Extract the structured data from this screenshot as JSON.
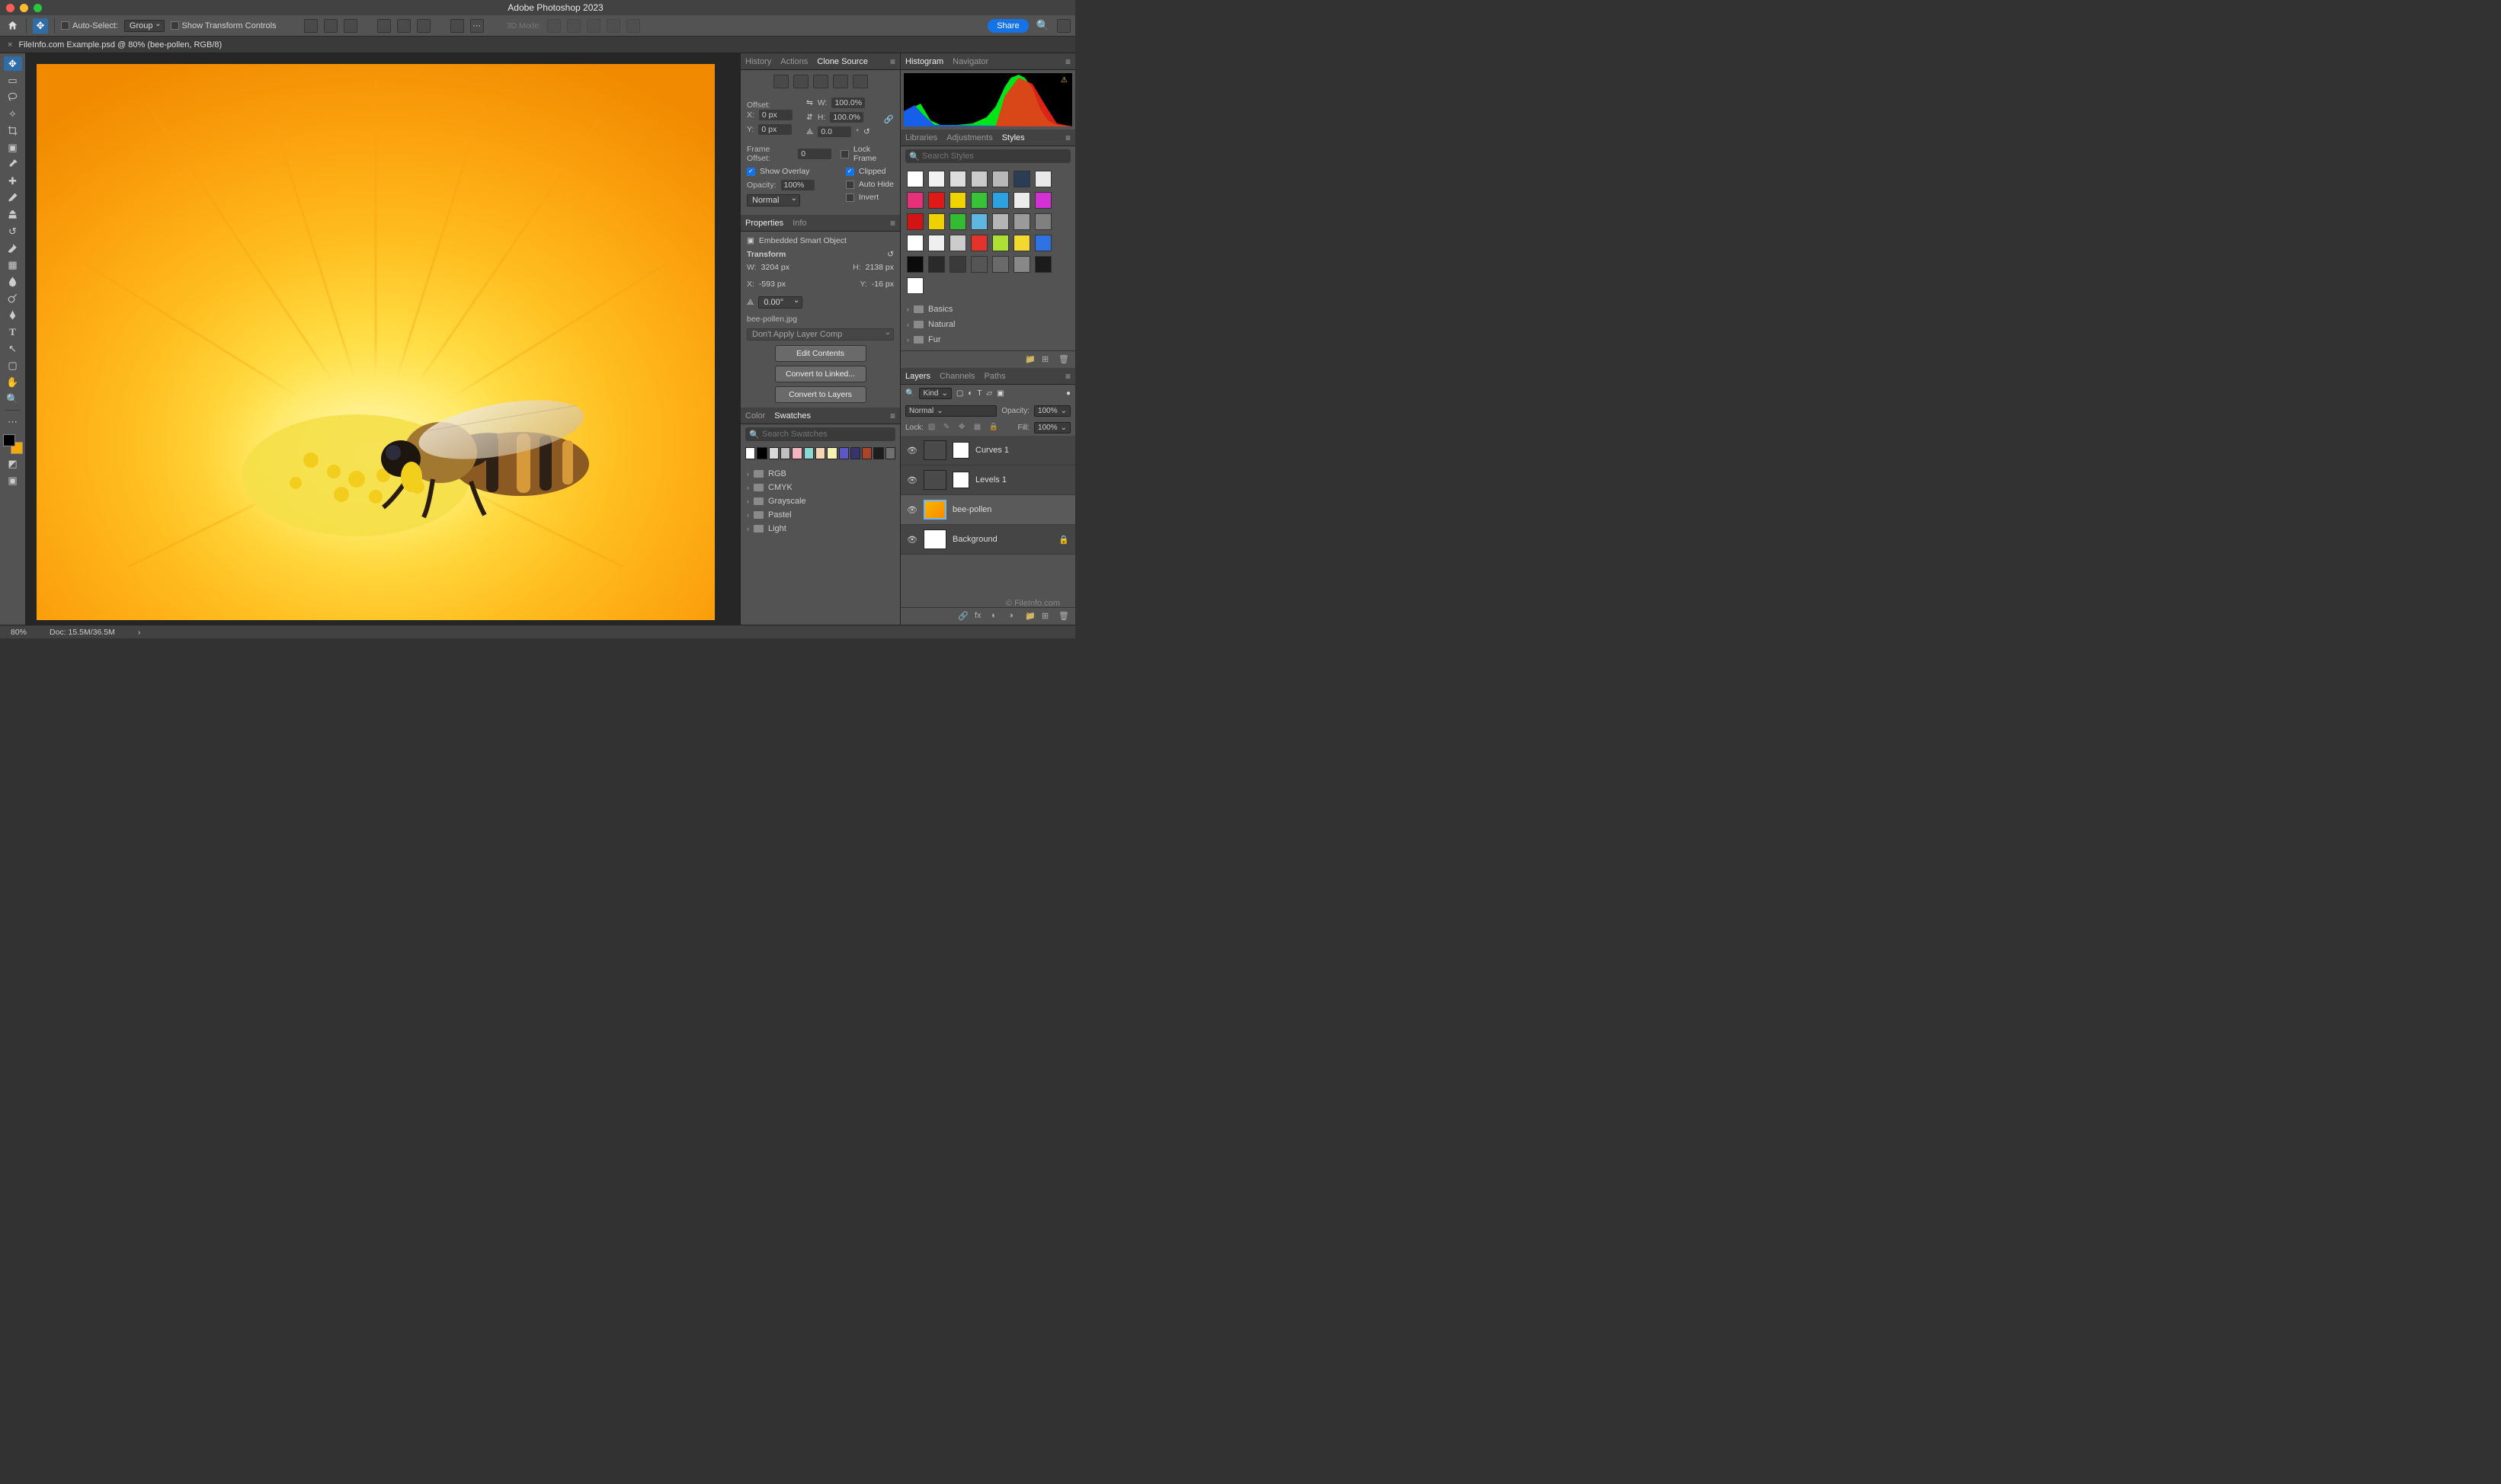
{
  "titlebar": {
    "title": "Adobe Photoshop 2023"
  },
  "optionsbar": {
    "auto_select_label": "Auto-Select:",
    "auto_select_target": "Group",
    "show_transform_label": "Show Transform Controls",
    "mode_3d_label": "3D Mode:",
    "share_label": "Share"
  },
  "doctab": {
    "label": "FileInfo.com Example.psd @ 80% (bee-pollen, RGB/8)"
  },
  "panels_left": {
    "tabs1": [
      "History",
      "Actions",
      "Clone Source"
    ],
    "tabs1_active": "Clone Source",
    "clone_source": {
      "offset_label": "Offset:",
      "x_label": "X:",
      "x_value": "0 px",
      "y_label": "Y:",
      "y_value": "0 px",
      "w_label": "W:",
      "w_value": "100.0%",
      "h_label": "H:",
      "h_value": "100.0%",
      "angle_value": "0.0",
      "frame_offset_label": "Frame Offset:",
      "frame_offset_value": "0",
      "lock_frame_label": "Lock Frame",
      "show_overlay_label": "Show Overlay",
      "clipped_label": "Clipped",
      "opacity_label": "Opacity:",
      "opacity_value": "100%",
      "auto_hide_label": "Auto Hide",
      "invert_label": "Invert",
      "blend_mode": "Normal"
    },
    "tabs2": [
      "Properties",
      "Info"
    ],
    "tabs2_active": "Properties",
    "properties": {
      "kind": "Embedded Smart Object",
      "transform_label": "Transform",
      "w_label": "W:",
      "w_value": "3204 px",
      "h_label": "H:",
      "h_value": "2138 px",
      "x_label": "X:",
      "x_value": "-593 px",
      "y_label": "Y:",
      "y_value": "-16 px",
      "angle_value": "0.00°",
      "source_file": "bee-pollen.jpg",
      "layer_comp": "Don't Apply Layer Comp",
      "btn_edit": "Edit Contents",
      "btn_linked": "Convert to Linked...",
      "btn_layers": "Convert to Layers"
    },
    "tabs3": [
      "Color",
      "Swatches"
    ],
    "tabs3_active": "Swatches",
    "swatches": {
      "search_placeholder": "Search Swatches",
      "row_colors": [
        "#ffffff",
        "#000000",
        "#d9d9d9",
        "#bfbfbf",
        "#f6b4c1",
        "#8bd9d4",
        "#f6d5b4",
        "#f5f3b4",
        "#5c57c9",
        "#37346f",
        "#ab452a",
        "#1d1d1d",
        "#707070"
      ],
      "folders": [
        "RGB",
        "CMYK",
        "Grayscale",
        "Pastel",
        "Light"
      ]
    }
  },
  "panels_right": {
    "tabs1": [
      "Histogram",
      "Navigator"
    ],
    "tabs1_active": "Histogram",
    "tabs2": [
      "Libraries",
      "Adjustments",
      "Styles"
    ],
    "tabs2_active": "Styles",
    "styles": {
      "search_placeholder": "Search Styles",
      "swatches": [
        "#ffffff",
        "#f1f1f1",
        "#dddddd",
        "#cacaca",
        "#b8b8b8",
        "#2b3d55",
        "#e9e9e9",
        "#e6307a",
        "#e01818",
        "#f0d400",
        "#38c238",
        "#2da2e0",
        "#ececec",
        "#d331d3",
        "#d41414",
        "#eed200",
        "#33bb33",
        "#5db7e0",
        "#b5b5b5",
        "#9a9a9a",
        "#808080",
        "#ffffff",
        "#efefef",
        "#cccccc",
        "#e4332b",
        "#aee033",
        "#f2d82f",
        "#2f72e4",
        "#0b0b0b",
        "#2a2a2a",
        "#3a3a3a",
        "#555555",
        "#6a6a6a",
        "#888888",
        "#1b1b1b",
        "#ffffff"
      ],
      "folders": [
        "Basics",
        "Natural",
        "Fur"
      ]
    },
    "tabs3": [
      "Layers",
      "Channels",
      "Paths"
    ],
    "tabs3_active": "Layers",
    "layers": {
      "kind_label": "Kind",
      "blend_mode": "Normal",
      "opacity_label": "Opacity:",
      "opacity_value": "100%",
      "lock_label": "Lock:",
      "fill_label": "Fill:",
      "fill_value": "100%",
      "list": [
        {
          "name": "Curves 1",
          "type": "adjustment",
          "visible": true
        },
        {
          "name": "Levels 1",
          "type": "adjustment",
          "visible": true
        },
        {
          "name": "bee-pollen",
          "type": "smartobject",
          "visible": true,
          "selected": true
        },
        {
          "name": "Background",
          "type": "background",
          "visible": true,
          "locked": true
        }
      ]
    }
  },
  "statusbar": {
    "zoom": "80%",
    "doc_info": "Doc: 15.5M/36.5M"
  },
  "watermark": "© FileInfo.com"
}
